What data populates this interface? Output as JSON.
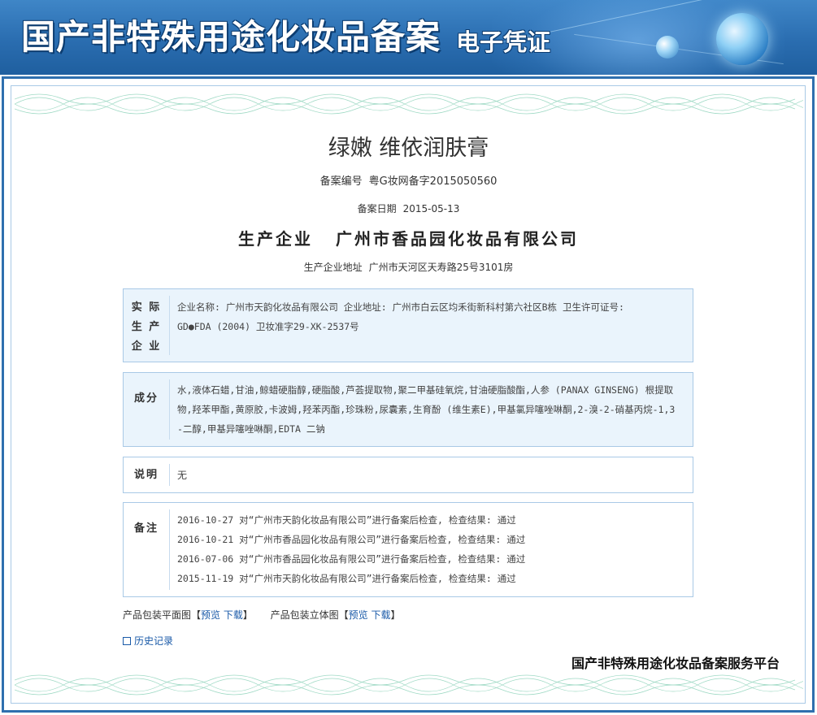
{
  "header": {
    "title": "国产非特殊用途化妆品备案",
    "subtitle": "电子凭证"
  },
  "certificate": {
    "product_name": "绿嫩 维依润肤膏",
    "record_no_label": "备案编号",
    "record_no": "粤G妆网备字2015050560",
    "record_date_label": "备案日期",
    "record_date": "2015-05-13",
    "producer_label": "生产企业",
    "producer": "广州市香品园化妆品有限公司",
    "producer_address_label": "生产企业地址",
    "producer_address": "广州市天河区天寿路25号3101房"
  },
  "sections": {
    "actual_producer": {
      "label": "实际生产企业",
      "label_lines": [
        "实 际",
        "生 产",
        "企 业"
      ],
      "line1": "企业名称: 广州市天韵化妆品有限公司  企业地址: 广州市白云区均禾街新科村第六社区B栋  卫生许可证号:",
      "line2": "GD●FDA (2004) 卫妆准字29-XK-2537号"
    },
    "ingredients": {
      "label": "成分",
      "lines": [
        "水,液体石蜡,甘油,鲸蜡硬脂醇,硬脂酸,芦荟提取物,聚二甲基硅氧烷,甘油硬脂酸酯,人参 (PANAX GINSENG) 根提取",
        "物,羟苯甲酯,黄原胶,卡波姆,羟苯丙酯,珍珠粉,尿囊素,生育酚 (维生素E),甲基氯异噻唑啉酮,2-溴-2-硝基丙烷-1,3",
        "-二醇,甲基异噻唑啉酮,EDTA 二钠"
      ]
    },
    "notes": {
      "label": "说明",
      "value": "无"
    },
    "remarks": {
      "label": "备注",
      "entries": [
        "2016-10-27 对“广州市天韵化妆品有限公司”进行备案后检查, 检查结果: 通过",
        "2016-10-21 对“广州市香品园化妆品有限公司”进行备案后检查, 检查结果: 通过",
        "2016-07-06 对“广州市香品园化妆品有限公司”进行备案后检查, 检查结果: 通过",
        "2015-11-19 对“广州市天韵化妆品有限公司”进行备案后检查, 检查结果: 通过"
      ]
    }
  },
  "packaging": {
    "flat_label": "产品包装平面图",
    "solid_label": "产品包装立体图",
    "preview": "预览",
    "download": "下载",
    "bracket_open": "【",
    "bracket_close": "】"
  },
  "history": {
    "label": "历史记录",
    "icon": "external-window-icon"
  },
  "footer": {
    "platform": "国产非特殊用途化妆品备案服务平台"
  },
  "colors": {
    "banner": "#2a6db0",
    "frame": "#2f6fae",
    "box_bg": "#eaf4fc",
    "link": "#1a5aa8"
  }
}
